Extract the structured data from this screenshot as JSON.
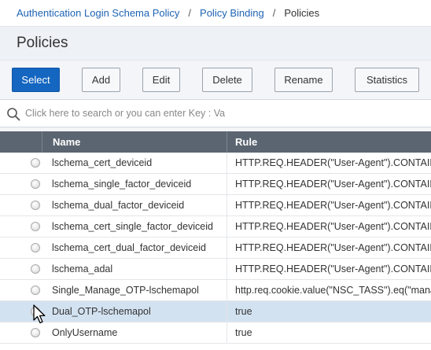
{
  "breadcrumb": {
    "items": [
      "Authentication Login Schema Policy",
      "Policy Binding"
    ],
    "separator": "/",
    "current": "Policies"
  },
  "page": {
    "title": "Policies"
  },
  "toolbar": {
    "select_label": "Select",
    "add_label": "Add",
    "edit_label": "Edit",
    "delete_label": "Delete",
    "rename_label": "Rename",
    "statistics_label": "Statistics"
  },
  "search": {
    "placeholder": "Click here to search or you can enter Key : Va"
  },
  "table": {
    "columns": [
      "Name",
      "Rule"
    ],
    "rows": [
      {
        "name": "lschema_cert_deviceid",
        "rule": "HTTP.REQ.HEADER(\"User-Agent\").CONTAINS(\"N"
      },
      {
        "name": "lschema_single_factor_deviceid",
        "rule": "HTTP.REQ.HEADER(\"User-Agent\").CONTAINS(\"N"
      },
      {
        "name": "lschema_dual_factor_deviceid",
        "rule": "HTTP.REQ.HEADER(\"User-Agent\").CONTAINS(\"N"
      },
      {
        "name": "lschema_cert_single_factor_deviceid",
        "rule": "HTTP.REQ.HEADER(\"User-Agent\").CONTAINS(\"N"
      },
      {
        "name": "lschema_cert_dual_factor_deviceid",
        "rule": "HTTP.REQ.HEADER(\"User-Agent\").CONTAINS(\"N"
      },
      {
        "name": "lschema_adal",
        "rule": "HTTP.REQ.HEADER(\"User-Agent\").CONTAINS(\"C"
      },
      {
        "name": "Single_Manage_OTP-lschemapol",
        "rule": "http.req.cookie.value(\"NSC_TASS\").eq(\"manage"
      },
      {
        "name": "Dual_OTP-lschemapol",
        "rule": "true",
        "selected": true
      },
      {
        "name": "OnlyUsername",
        "rule": "true"
      }
    ]
  },
  "colors": {
    "link": "#1e63b4",
    "primary_button": "#1466c0",
    "table_header": "#5b6571",
    "selected_row": "#d3e2f1"
  }
}
